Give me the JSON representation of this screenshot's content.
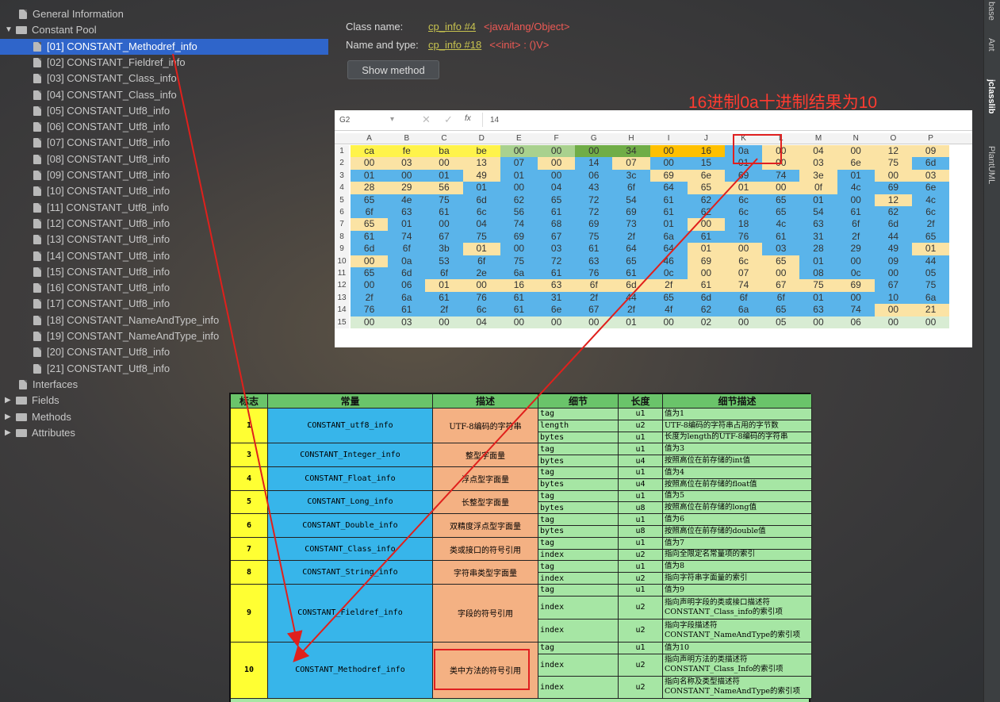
{
  "tree": {
    "items": [
      {
        "label": "General Information",
        "kind": "doc"
      },
      {
        "label": "Constant Pool",
        "kind": "folder-open"
      },
      {
        "label": "[01] CONSTANT_Methodref_info",
        "kind": "doc",
        "selected": true
      },
      {
        "label": "[02] CONSTANT_Fieldref_info",
        "kind": "doc"
      },
      {
        "label": "[03] CONSTANT_Class_info",
        "kind": "doc"
      },
      {
        "label": "[04] CONSTANT_Class_info",
        "kind": "doc"
      },
      {
        "label": "[05] CONSTANT_Utf8_info",
        "kind": "doc"
      },
      {
        "label": "[06] CONSTANT_Utf8_info",
        "kind": "doc"
      },
      {
        "label": "[07] CONSTANT_Utf8_info",
        "kind": "doc"
      },
      {
        "label": "[08] CONSTANT_Utf8_info",
        "kind": "doc"
      },
      {
        "label": "[09] CONSTANT_Utf8_info",
        "kind": "doc"
      },
      {
        "label": "[10] CONSTANT_Utf8_info",
        "kind": "doc"
      },
      {
        "label": "[11] CONSTANT_Utf8_info",
        "kind": "doc"
      },
      {
        "label": "[12] CONSTANT_Utf8_info",
        "kind": "doc"
      },
      {
        "label": "[13] CONSTANT_Utf8_info",
        "kind": "doc"
      },
      {
        "label": "[14] CONSTANT_Utf8_info",
        "kind": "doc"
      },
      {
        "label": "[15] CONSTANT_Utf8_info",
        "kind": "doc"
      },
      {
        "label": "[16] CONSTANT_Utf8_info",
        "kind": "doc"
      },
      {
        "label": "[17] CONSTANT_Utf8_info",
        "kind": "doc"
      },
      {
        "label": "[18] CONSTANT_NameAndType_info",
        "kind": "doc"
      },
      {
        "label": "[19] CONSTANT_NameAndType_info",
        "kind": "doc"
      },
      {
        "label": "[20] CONSTANT_Utf8_info",
        "kind": "doc"
      },
      {
        "label": "[21] CONSTANT_Utf8_info",
        "kind": "doc"
      },
      {
        "label": "Interfaces",
        "kind": "doc"
      },
      {
        "label": "Fields",
        "kind": "folder-closed"
      },
      {
        "label": "Methods",
        "kind": "folder-closed"
      },
      {
        "label": "Attributes",
        "kind": "folder-closed"
      }
    ]
  },
  "info": {
    "class_label": "Class name:",
    "class_link": "cp_info #4",
    "class_value": "<java/lang/Object>",
    "nt_label": "Name and type:",
    "nt_link": "cp_info #18",
    "nt_value": "<<init> : ()V>",
    "button": "Show method"
  },
  "note": "16进制0a十进制结果为10",
  "excel": {
    "cell_ref": "G2",
    "formula_value": "14",
    "columns": [
      "A",
      "B",
      "C",
      "D",
      "E",
      "F",
      "G",
      "H",
      "I",
      "J",
      "K",
      "L",
      "M",
      "N",
      "O",
      "P"
    ],
    "rows": [
      [
        "ca",
        "fe",
        "ba",
        "be",
        "00",
        "00",
        "00",
        "34",
        "00",
        "16",
        "0a",
        "00",
        "04",
        "00",
        "12",
        "09"
      ],
      [
        "00",
        "03",
        "00",
        "13",
        "07",
        "00",
        "14",
        "07",
        "00",
        "15",
        "01",
        "00",
        "03",
        "6e",
        "75",
        "6d"
      ],
      [
        "01",
        "00",
        "01",
        "49",
        "01",
        "00",
        "06",
        "3c",
        "69",
        "6e",
        "69",
        "74",
        "3e",
        "01",
        "00",
        "03"
      ],
      [
        "28",
        "29",
        "56",
        "01",
        "00",
        "04",
        "43",
        "6f",
        "64",
        "65",
        "01",
        "00",
        "0f",
        "4c",
        "69",
        "6e"
      ],
      [
        "65",
        "4e",
        "75",
        "6d",
        "62",
        "65",
        "72",
        "54",
        "61",
        "62",
        "6c",
        "65",
        "01",
        "00",
        "12",
        "4c"
      ],
      [
        "6f",
        "63",
        "61",
        "6c",
        "56",
        "61",
        "72",
        "69",
        "61",
        "62",
        "6c",
        "65",
        "54",
        "61",
        "62",
        "6c"
      ],
      [
        "65",
        "01",
        "00",
        "04",
        "74",
        "68",
        "69",
        "73",
        "01",
        "00",
        "18",
        "4c",
        "63",
        "6f",
        "6d",
        "2f"
      ],
      [
        "61",
        "74",
        "67",
        "75",
        "69",
        "67",
        "75",
        "2f",
        "6a",
        "61",
        "76",
        "61",
        "31",
        "2f",
        "44",
        "65"
      ],
      [
        "6d",
        "6f",
        "3b",
        "01",
        "00",
        "03",
        "61",
        "64",
        "64",
        "01",
        "00",
        "03",
        "28",
        "29",
        "49",
        "01"
      ],
      [
        "00",
        "0a",
        "53",
        "6f",
        "75",
        "72",
        "63",
        "65",
        "46",
        "69",
        "6c",
        "65",
        "01",
        "00",
        "09",
        "44"
      ],
      [
        "65",
        "6d",
        "6f",
        "2e",
        "6a",
        "61",
        "76",
        "61",
        "0c",
        "00",
        "07",
        "00",
        "08",
        "0c",
        "00",
        "05"
      ],
      [
        "00",
        "06",
        "01",
        "00",
        "16",
        "63",
        "6f",
        "6d",
        "2f",
        "61",
        "74",
        "67",
        "75",
        "69",
        "67",
        "75"
      ],
      [
        "2f",
        "6a",
        "61",
        "76",
        "61",
        "31",
        "2f",
        "44",
        "65",
        "6d",
        "6f",
        "6f",
        "01",
        "00",
        "10",
        "6a"
      ],
      [
        "76",
        "61",
        "2f",
        "6c",
        "61",
        "6e",
        "67",
        "2f",
        "4f",
        "62",
        "6a",
        "65",
        "63",
        "74",
        "00",
        "21"
      ],
      [
        "00",
        "03",
        "00",
        "04",
        "00",
        "00",
        "00",
        "01",
        "00",
        "02",
        "00",
        "05",
        "00",
        "06",
        "00",
        "00"
      ]
    ]
  },
  "table": {
    "headers": [
      "标志",
      "常量",
      "描述",
      "细节",
      "长度",
      "细节描述"
    ],
    "groups": [
      {
        "flag": "1",
        "name": "CONSTANT_utf8_info",
        "desc": "UTF-8编码的字符串",
        "rows": [
          [
            "tag",
            "u1",
            "值为1"
          ],
          [
            "length",
            "u2",
            "UTF-8编码的字符串占用的字节数"
          ],
          [
            "bytes",
            "u1",
            "长度为length的UTF-8编码的字符串"
          ]
        ]
      },
      {
        "flag": "3",
        "name": "CONSTANT_Integer_info",
        "desc": "整型字面量",
        "rows": [
          [
            "tag",
            "u1",
            "值为3"
          ],
          [
            "bytes",
            "u4",
            "按照高位在前存储的int值"
          ]
        ]
      },
      {
        "flag": "4",
        "name": "CONSTANT_Float_info",
        "desc": "浮点型字面量",
        "rows": [
          [
            "tag",
            "u1",
            "值为4"
          ],
          [
            "bytes",
            "u4",
            "按照高位在前存储的float值"
          ]
        ]
      },
      {
        "flag": "5",
        "name": "CONSTANT_Long_info",
        "desc": "长整型字面量",
        "rows": [
          [
            "tag",
            "u1",
            "值为5"
          ],
          [
            "bytes",
            "u8",
            "按照高位在前存储的long值"
          ]
        ]
      },
      {
        "flag": "6",
        "name": "CONSTANT_Double_info",
        "desc": "双精度浮点型字面量",
        "rows": [
          [
            "tag",
            "u1",
            "值为6"
          ],
          [
            "bytes",
            "u8",
            "按照高位在前存储的double值"
          ]
        ]
      },
      {
        "flag": "7",
        "name": "CONSTANT_Class_info",
        "desc": "类或接口的符号引用",
        "rows": [
          [
            "tag",
            "u1",
            "值为7"
          ],
          [
            "index",
            "u2",
            "指向全限定名常量项的索引"
          ]
        ]
      },
      {
        "flag": "8",
        "name": "CONSTANT_String_info",
        "desc": "字符串类型字面量",
        "rows": [
          [
            "tag",
            "u1",
            "值为8"
          ],
          [
            "index",
            "u2",
            "指向字符串字面量的索引"
          ]
        ]
      },
      {
        "flag": "9",
        "name": "CONSTANT_Fieldref_info",
        "desc": "字段的符号引用",
        "rows": [
          [
            "tag",
            "u1",
            "值为9"
          ],
          [
            "index",
            "u2",
            "指向声明字段的类或接口描述符 CONSTANT_Class_info的索引项"
          ],
          [
            "index",
            "u2",
            "指向字段描述符 CONSTANT_NameAndType的索引项"
          ]
        ]
      },
      {
        "flag": "10",
        "name": "CONSTANT_Methodref_info",
        "desc": "类中方法的符号引用",
        "rows": [
          [
            "tag",
            "u1",
            "值为10"
          ],
          [
            "index",
            "u2",
            "指向声明方法的类描述符 CONSTANT_Class_Info的索引项"
          ],
          [
            "index",
            "u2",
            "指向名称及类型描述符 CONSTANT_NameAndType的索引项"
          ]
        ]
      }
    ]
  },
  "side_tabs": [
    "base",
    "Ant",
    "jclasslib",
    "PlantUML"
  ]
}
